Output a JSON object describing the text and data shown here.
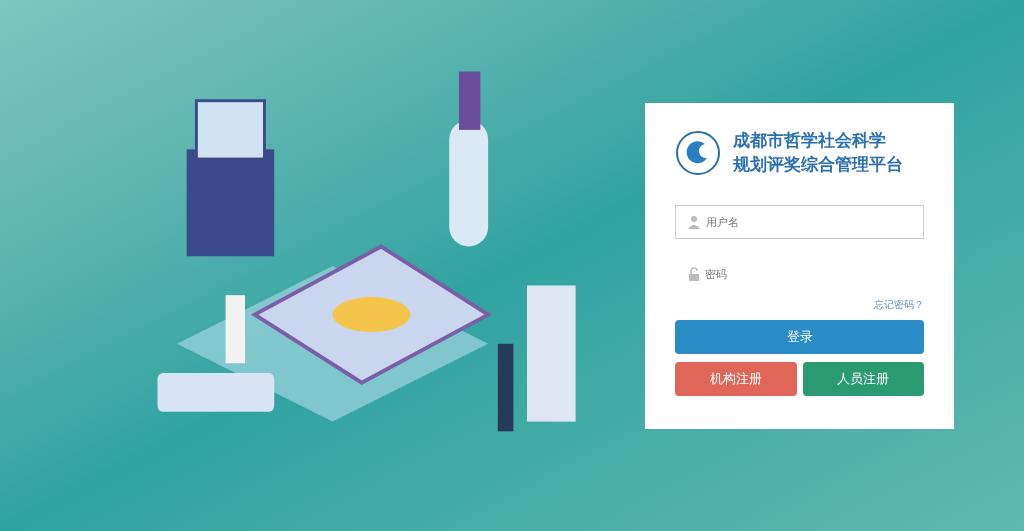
{
  "title_lines": [
    "成都市哲学社会科学",
    "规划评奖综合管理平台"
  ],
  "username": {
    "placeholder": "用户名"
  },
  "password": {
    "placeholder": "密码"
  },
  "forgot_link": "忘记密码？",
  "login_button": "登录",
  "register_buttons": [
    {
      "kind": "org",
      "label": "机构注册"
    },
    {
      "kind": "person",
      "label": "人员注册"
    }
  ]
}
